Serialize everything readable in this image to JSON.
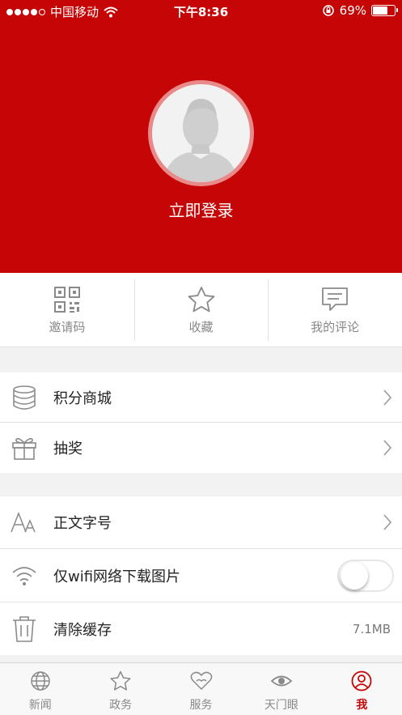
{
  "status_bar": {
    "carrier": "中国移动",
    "time": "下午8:36",
    "battery_text": "69%",
    "battery_level": 0.69
  },
  "profile": {
    "login_label": "立即登录",
    "avatar_icon": "default-avatar-icon"
  },
  "quick_actions": [
    {
      "label": "邀请码",
      "icon": "qrcode-icon"
    },
    {
      "label": "收藏",
      "icon": "star-icon"
    },
    {
      "label": "我的评论",
      "icon": "comment-icon"
    }
  ],
  "menu_group_1": [
    {
      "label": "积分商城",
      "icon": "database-icon"
    },
    {
      "label": "抽奖",
      "icon": "gift-icon"
    }
  ],
  "menu_group_2": {
    "font_size": {
      "label": "正文字号",
      "icon": "font-size-icon"
    },
    "wifi_images": {
      "label": "仅wifi网络下载图片",
      "icon": "wifi-icon",
      "enabled": false
    },
    "clear_cache": {
      "label": "清除缓存",
      "icon": "trash-icon",
      "value": "7.1MB"
    }
  },
  "tabs": [
    {
      "label": "新闻",
      "icon": "globe-icon"
    },
    {
      "label": "政务",
      "icon": "star-icon"
    },
    {
      "label": "服务",
      "icon": "heart-hands-icon"
    },
    {
      "label": "天门眼",
      "icon": "eye-icon"
    },
    {
      "label": "我",
      "icon": "user-icon",
      "active": true
    }
  ],
  "colors": {
    "brand_red": "#c60606",
    "background": "#f2f2f2",
    "muted_text": "#888888"
  }
}
